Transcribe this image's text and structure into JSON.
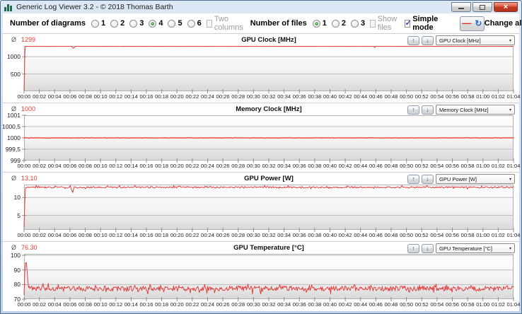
{
  "window": {
    "title": "Generic Log Viewer 3.2 - © 2018 Thomas Barth"
  },
  "icons": {
    "close": "×",
    "up_arrow": "↑",
    "down_arrow": "↓",
    "refresh": "↻",
    "red_dash": "—",
    "dropdown_arrow": "▾"
  },
  "toolbar": {
    "diagrams_label": "Number of diagrams",
    "diagram_options": [
      "1",
      "2",
      "3",
      "4",
      "5",
      "6"
    ],
    "diagrams_selected": "4",
    "two_columns": {
      "label": "Two columns",
      "checked": false,
      "enabled": false
    },
    "files_label": "Number of files",
    "file_options": [
      "1",
      "2",
      "3"
    ],
    "files_selected": "1",
    "show_files": {
      "label": "Show files",
      "checked": false,
      "enabled": false
    },
    "simple_mode": {
      "label": "Simple mode",
      "checked": true,
      "enabled": true
    },
    "change_all_label": "Change all"
  },
  "x_axis_labels": [
    "00:00",
    "00:02",
    "00:04",
    "00:06",
    "00:08",
    "00:10",
    "00:12",
    "00:14",
    "00:16",
    "00:18",
    "00:20",
    "00:22",
    "00:24",
    "00:26",
    "00:28",
    "00:30",
    "00:32",
    "00:34",
    "00:36",
    "00:38",
    "00:40",
    "00:42",
    "00:44",
    "00:46",
    "00:48",
    "00:50",
    "00:52",
    "00:54",
    "00:56",
    "00:58",
    "01:00",
    "01:02",
    "01:04"
  ],
  "chart_data": [
    {
      "type": "line",
      "title": "GPU Clock [MHz]",
      "average_symbol": "Ø",
      "average": "1299",
      "selector_value": "GPU Clock [MHz]",
      "x_start": "00:00",
      "x_end": "01:04",
      "y_range": [
        0,
        1310
      ],
      "y_ticks": [
        {
          "value": 1000,
          "label": "1000"
        },
        {
          "value": 500,
          "label": "500"
        }
      ],
      "series": {
        "name": "GPU Clock",
        "color": "#e23d3d",
        "width": 1,
        "duration_min": 64.5,
        "baseline": 1299,
        "noise": 1.2,
        "clamp": [
          0,
          1300
        ],
        "start": {
          "value": 25,
          "ramp_min": 0.12
        },
        "events": [
          {
            "minute": 6.5,
            "value": 1242,
            "width_min": 0.5
          },
          {
            "minute": 46.2,
            "value": 1268,
            "width_min": 0.3
          }
        ]
      }
    },
    {
      "type": "line",
      "title": "Memory Clock [MHz]",
      "average_symbol": "Ø",
      "average": "1000",
      "selector_value": "Memory Clock [MHz]",
      "x_start": "00:00",
      "x_end": "01:04",
      "y_range": [
        999,
        1001
      ],
      "y_ticks": [
        {
          "value": 1001,
          "label": "1001"
        },
        {
          "value": 1000.5,
          "label": "1000,5"
        },
        {
          "value": 1000,
          "label": "1000"
        },
        {
          "value": 999.5,
          "label": "999,5"
        },
        {
          "value": 999,
          "label": "999"
        }
      ],
      "series": {
        "name": "Memory Clock",
        "color": "#ef5a50",
        "width": 1.6,
        "duration_min": 64.5,
        "baseline": 1000,
        "noise": 0.01,
        "clamp": [
          999.95,
          1000.05
        ],
        "events": []
      }
    },
    {
      "type": "line",
      "title": "GPU Power [W]",
      "average_symbol": "Ø",
      "average": "13.10",
      "selector_value": "GPU Power [W]",
      "x_start": "00:00",
      "x_end": "01:04",
      "y_range": [
        1.0,
        13.6
      ],
      "y_ticks": [
        {
          "value": 10,
          "label": "10"
        },
        {
          "value": 5,
          "label": "5"
        }
      ],
      "series": {
        "name": "GPU Power",
        "color": "#e23d3d",
        "width": 1,
        "duration_min": 64.5,
        "baseline": 12.85,
        "noise": 0.2,
        "noise2": {
          "amp": 0.45,
          "prob": 0.12
        },
        "clamp": [
          12.2,
          13.35
        ],
        "start": {
          "value": 1.8,
          "ramp_min": 0.15
        },
        "events": [
          {
            "minute": 6.4,
            "value": 11.4,
            "width_min": 0.5
          }
        ]
      }
    },
    {
      "type": "line",
      "title": "GPU Temperature [°C]",
      "average_symbol": "Ø",
      "average": "76.30",
      "selector_value": "GPU Temperature [°C]",
      "x_start": "00:00",
      "x_end": "01:04",
      "y_range": [
        70,
        101
      ],
      "y_ticks": [
        {
          "value": 100,
          "label": "100"
        },
        {
          "value": 90,
          "label": "90"
        },
        {
          "value": 80,
          "label": "80"
        },
        {
          "value": 70,
          "label": "70"
        }
      ],
      "series": {
        "name": "GPU Temperature",
        "color": "#e23d3d",
        "width": 1,
        "duration_min": 64.5,
        "baseline": 77.3,
        "noise": 1.7,
        "noise2": {
          "amp": 2.6,
          "prob": 0.2
        },
        "clamp": [
          73.6,
          82.5
        ],
        "start": {
          "value": 73,
          "ramp_min": 0.06
        },
        "events": [
          {
            "minute": 0.25,
            "value": 98,
            "width_min": 0.7
          }
        ]
      }
    }
  ]
}
